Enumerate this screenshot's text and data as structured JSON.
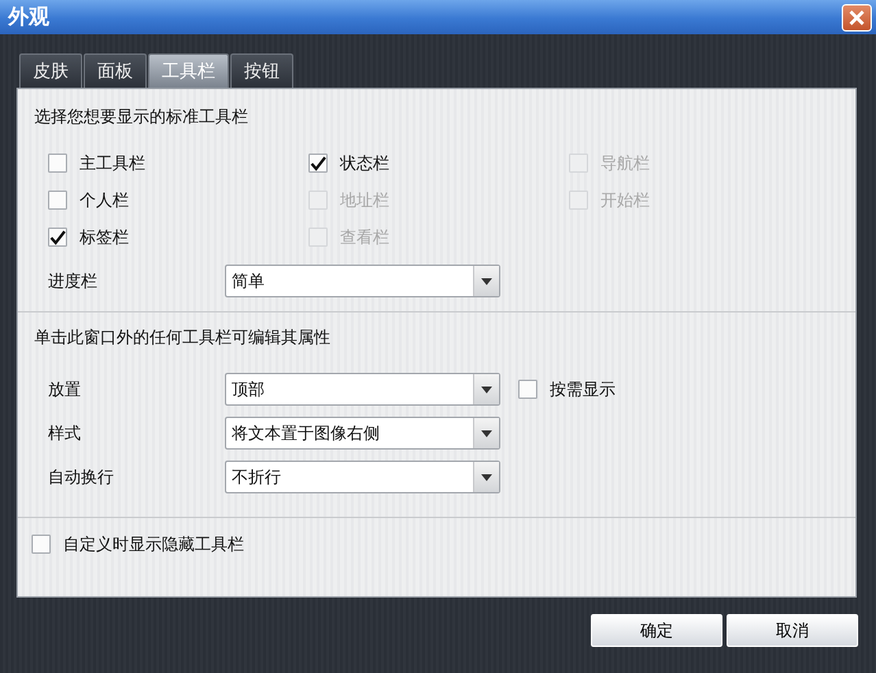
{
  "window": {
    "title": "外观"
  },
  "tabs": [
    {
      "label": "皮肤",
      "selected": false
    },
    {
      "label": "面板",
      "selected": false
    },
    {
      "label": "工具栏",
      "selected": true
    },
    {
      "label": "按钮",
      "selected": false
    }
  ],
  "standard_toolbars": {
    "heading": "选择您想要显示的标准工具栏",
    "columns": [
      {
        "options": [
          {
            "label": "主工具栏",
            "checked": false,
            "disabled": false
          },
          {
            "label": "个人栏",
            "checked": false,
            "disabled": false
          },
          {
            "label": "标签栏",
            "checked": true,
            "disabled": false
          }
        ]
      },
      {
        "options": [
          {
            "label": "状态栏",
            "checked": true,
            "disabled": false
          },
          {
            "label": "地址栏",
            "checked": false,
            "disabled": true
          },
          {
            "label": "查看栏",
            "checked": false,
            "disabled": true
          }
        ]
      },
      {
        "options": [
          {
            "label": "导航栏",
            "checked": false,
            "disabled": true
          },
          {
            "label": "开始栏",
            "checked": false,
            "disabled": true
          }
        ]
      }
    ],
    "progress": {
      "label": "进度栏",
      "value": "简单"
    }
  },
  "toolbar_properties": {
    "heading": "单击此窗口外的任何工具栏可编辑其属性",
    "rows": [
      {
        "label": "放置",
        "value": "顶部"
      },
      {
        "label": "样式",
        "value": "将文本置于图像右侧"
      },
      {
        "label": "自动换行",
        "value": "不折行"
      }
    ],
    "show_on_demand": {
      "label": "按需显示",
      "checked": false
    }
  },
  "show_hidden": {
    "label": "自定义时显示隐藏工具栏",
    "checked": false
  },
  "buttons": [
    "确定",
    "取消"
  ]
}
